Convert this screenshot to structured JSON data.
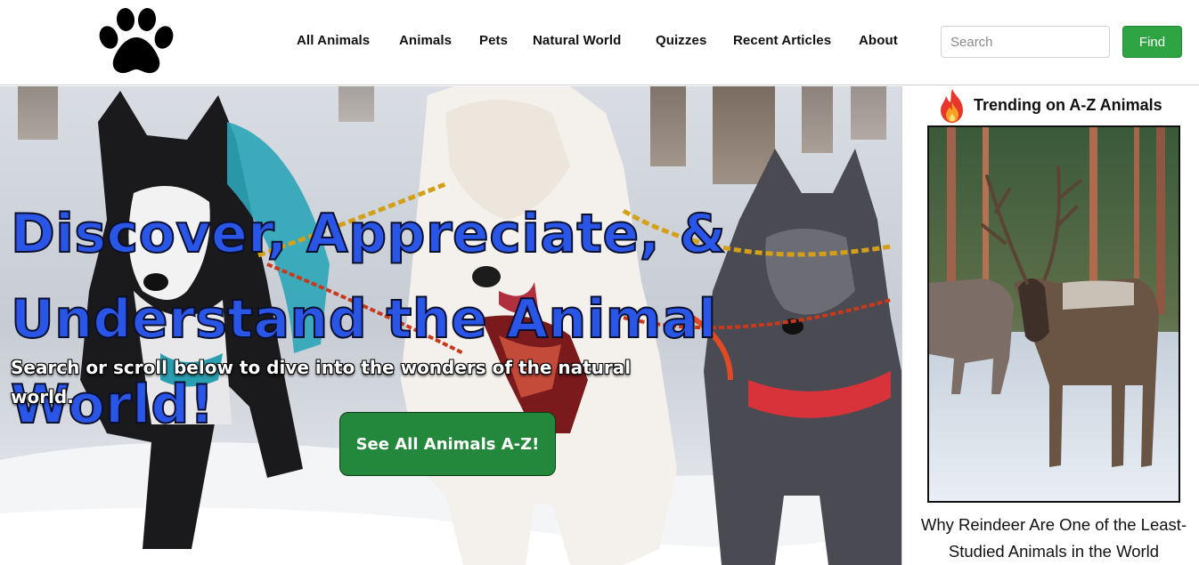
{
  "header": {
    "logo_icon": "paw-print-icon",
    "nav": [
      {
        "label": "All Animals"
      },
      {
        "label": "Animals"
      },
      {
        "label": "Pets"
      },
      {
        "label": "Natural World"
      },
      {
        "label": "Quizzes"
      },
      {
        "label": "Recent Articles"
      },
      {
        "label": "About"
      }
    ],
    "search": {
      "placeholder": "Search",
      "value": ""
    },
    "find_label": "Find",
    "colors": {
      "find_button": "#2ea443"
    }
  },
  "hero": {
    "title": "Discover, Appreciate, & Understand the Animal World!",
    "subtitle": "Search or scroll below to dive into the wonders of the natural world.",
    "cta_label": "See All Animals A-Z!",
    "image": "sled-dogs-huskies-in-snow",
    "colors": {
      "title": "#2a56e8",
      "cta": "#24883c"
    }
  },
  "sidebar": {
    "trending_icon": "fire-icon",
    "trending_title": "Trending on A-Z Animals",
    "article": {
      "image": "reindeer-in-snowy-forest",
      "title": "Why Reindeer Are One of the Least-Studied Animals in the World"
    }
  }
}
